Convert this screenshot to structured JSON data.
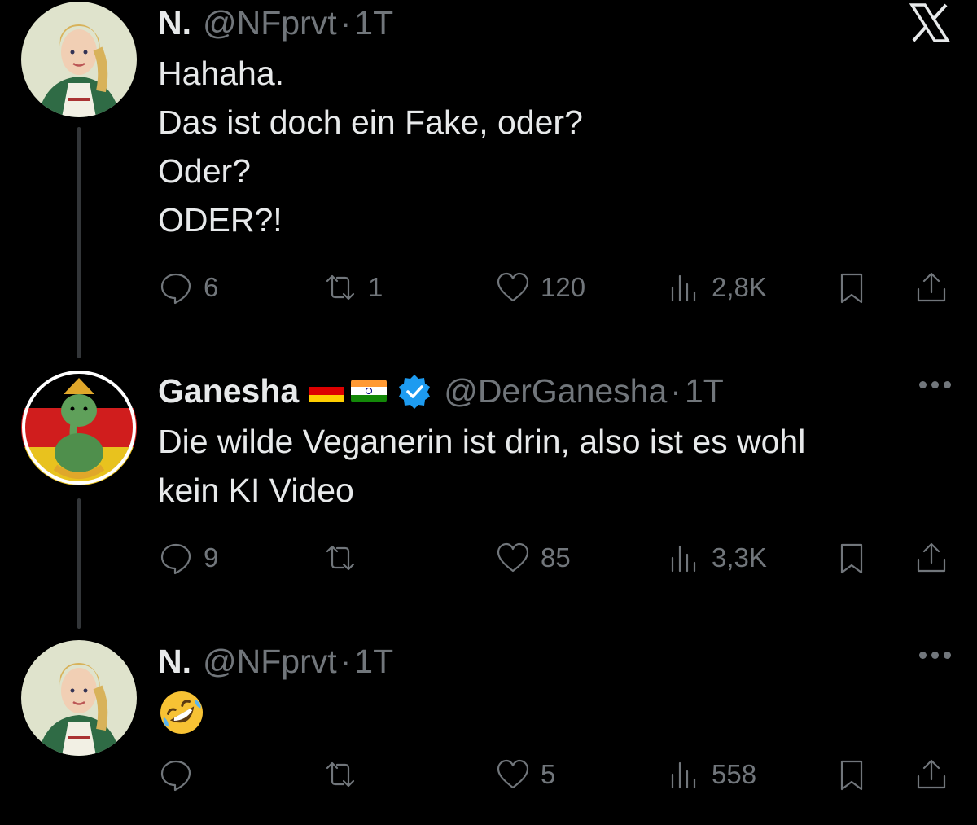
{
  "tweets": [
    {
      "name": "N.",
      "handle": "@NFprvt",
      "sep": "·",
      "time": "1T",
      "lines": [
        "Hahaha.",
        "Das ist doch ein Fake, oder?",
        "Oder?",
        "ODER?!"
      ],
      "replies": "6",
      "retweets": "1",
      "likes": "120",
      "views": "2,8K",
      "avatar": "woman-in-dirndl-avatar"
    },
    {
      "name": "Ganesha",
      "flags": [
        "flag-germany",
        "flag-india"
      ],
      "verified": true,
      "handle": "@DerGanesha",
      "sep": "·",
      "time": "1T",
      "lines": [
        "Die wilde Veganerin ist drin, also ist es wohl",
        "kein KI Video"
      ],
      "replies": "9",
      "retweets": "",
      "likes": "85",
      "views": "3,3K",
      "avatar": "ganesha-avatar"
    },
    {
      "name": "N.",
      "handle": "@NFprvt",
      "sep": "·",
      "time": "1T",
      "emoji": "rolling-on-floor-laughing-emoji",
      "replies": "",
      "retweets": "",
      "likes": "5",
      "views": "558",
      "avatar": "woman-in-dirndl-avatar"
    }
  ],
  "colors": {
    "background": "#000000",
    "text": "#e7e9ea",
    "secondary": "#71767b",
    "verified": "#1d9bf0"
  }
}
